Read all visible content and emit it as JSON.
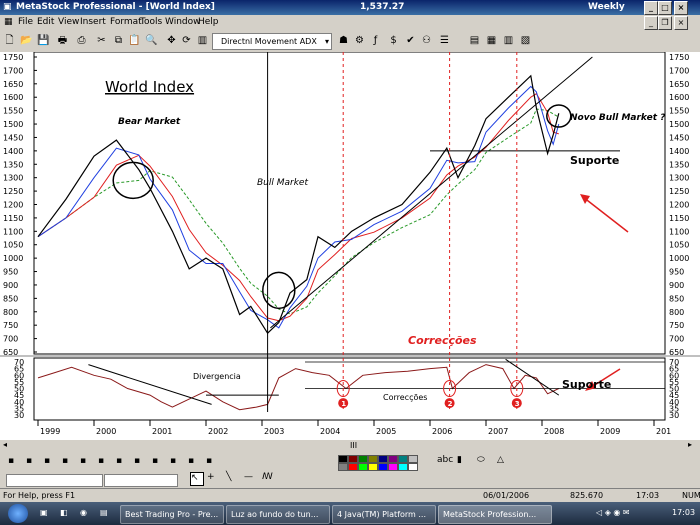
{
  "window": {
    "title": "MetaStock Professional - [World Index]",
    "price": "1,537.27",
    "period": "Weekly"
  },
  "menu": [
    "File",
    "Edit",
    "View",
    "Insert",
    "Format",
    "Tools",
    "Window",
    "Help"
  ],
  "toolbar": {
    "indicator_combo": "Directnl Movement ADX"
  },
  "chart_labels": {
    "title": "World Index",
    "bear": "Bear Market",
    "bull": "Bull Market",
    "novo": "Novo Bull Market ?",
    "suporte": "Suporte",
    "correccoes_main": "Correcções",
    "divergencia": "Divergencia",
    "correccoes_low": "Correcções",
    "suporte_low": "Suporte",
    "markers": [
      "1",
      "2",
      "3"
    ]
  },
  "chart_data": [
    {
      "type": "line",
      "title": "World Index",
      "ylim": [
        650,
        1750
      ],
      "y_ticks": [
        650,
        700,
        750,
        800,
        850,
        900,
        950,
        1000,
        1050,
        1100,
        1150,
        1200,
        1250,
        1300,
        1350,
        1400,
        1450,
        1500,
        1550,
        1600,
        1650,
        1700,
        1750
      ],
      "x_ticks": [
        "1999",
        "2000",
        "2001",
        "2002",
        "2003",
        "2004",
        "2005",
        "2006",
        "2007",
        "2008",
        "2009",
        "201"
      ],
      "series": [
        {
          "values_by_year": [
            [
              1999.0,
              1080
            ],
            [
              1999.5,
              1220
            ],
            [
              2000.0,
              1380
            ],
            [
              2000.4,
              1440
            ],
            [
              2000.8,
              1330
            ],
            [
              2001.0,
              1260
            ],
            [
              2001.4,
              1100
            ],
            [
              2001.7,
              960
            ],
            [
              2002.0,
              1000
            ],
            [
              2002.3,
              960
            ],
            [
              2002.6,
              790
            ],
            [
              2002.8,
              820
            ],
            [
              2003.1,
              720
            ],
            [
              2003.3,
              760
            ],
            [
              2003.5,
              870
            ],
            [
              2003.8,
              920
            ],
            [
              2004.0,
              1080
            ],
            [
              2004.3,
              1040
            ],
            [
              2004.6,
              1100
            ],
            [
              2005.0,
              1150
            ],
            [
              2005.5,
              1200
            ],
            [
              2006.0,
              1320
            ],
            [
              2006.3,
              1410
            ],
            [
              2006.5,
              1300
            ],
            [
              2006.8,
              1420
            ],
            [
              2007.0,
              1520
            ],
            [
              2007.4,
              1600
            ],
            [
              2007.8,
              1680
            ],
            [
              2007.9,
              1560
            ],
            [
              2008.1,
              1390
            ],
            [
              2008.2,
              1460
            ],
            [
              2008.3,
              1540
            ]
          ]
        }
      ]
    },
    {
      "type": "line",
      "ylim": [
        30,
        70
      ],
      "y_ticks": [
        30,
        35,
        40,
        45,
        50,
        55,
        60,
        65,
        70
      ],
      "series": [
        {
          "values_by_year": [
            [
              1999.0,
              58
            ],
            [
              1999.3,
              62
            ],
            [
              1999.6,
              66
            ],
            [
              2000.0,
              60
            ],
            [
              2000.3,
              57
            ],
            [
              2000.6,
              50
            ],
            [
              2001.0,
              45
            ],
            [
              2001.2,
              40
            ],
            [
              2001.4,
              36
            ],
            [
              2001.7,
              42
            ],
            [
              2002.0,
              48
            ],
            [
              2002.3,
              40
            ],
            [
              2002.6,
              34
            ],
            [
              2002.9,
              36
            ],
            [
              2003.1,
              38
            ],
            [
              2003.3,
              58
            ],
            [
              2003.6,
              65
            ],
            [
              2003.9,
              62
            ],
            [
              2004.2,
              60
            ],
            [
              2004.5,
              50
            ],
            [
              2004.8,
              60
            ],
            [
              2005.2,
              62
            ],
            [
              2005.6,
              63
            ],
            [
              2006.0,
              65
            ],
            [
              2006.3,
              66
            ],
            [
              2006.4,
              50
            ],
            [
              2006.7,
              62
            ],
            [
              2007.0,
              68
            ],
            [
              2007.3,
              65
            ],
            [
              2007.5,
              50
            ],
            [
              2007.7,
              60
            ],
            [
              2007.9,
              58
            ],
            [
              2008.1,
              46
            ],
            [
              2008.3,
              50
            ]
          ]
        }
      ]
    }
  ],
  "bottombar": {
    "scroll_label": "III"
  },
  "statusbar": {
    "help": "For Help, press F1",
    "date": "06/01/2006",
    "value": "825.670",
    "time": "17:03",
    "num": "NUM"
  },
  "taskbar": {
    "items": [
      "Best Trading Pro - Pre...",
      "Luz ao fundo do tun...",
      "4 Java(TM) Platform ...",
      "MetaStock Profession..."
    ],
    "clock": "17:03"
  }
}
